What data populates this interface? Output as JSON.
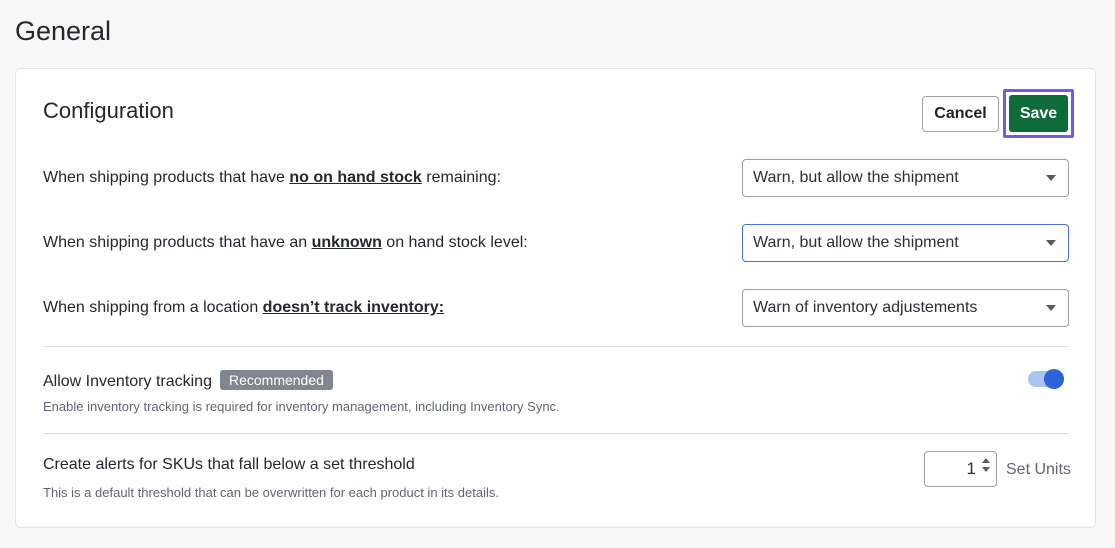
{
  "page": {
    "title": "General"
  },
  "config": {
    "title": "Configuration",
    "cancel_label": "Cancel",
    "save_label": "Save",
    "rows": [
      {
        "prefix": "When shipping products that have ",
        "emphasis": "no on hand stock",
        "suffix": " remaining:",
        "selected": "Warn, but allow the shipment"
      },
      {
        "prefix": "When shipping products that have an ",
        "emphasis": "unknown",
        "suffix": " on hand stock level:",
        "selected": "Warn, but allow the shipment"
      },
      {
        "prefix": "When shipping from a location ",
        "emphasis": "doesn’t track inventory:",
        "suffix": "",
        "selected": "Warn of inventory adjustements"
      }
    ],
    "tracking": {
      "label": "Allow Inventory tracking",
      "badge": "Recommended",
      "description": "Enable inventory tracking is required for inventory management, including Inventory Sync.",
      "enabled": true
    },
    "alerts": {
      "label": "Create alerts for SKUs that fall below a set threshold",
      "description": "This is a default threshold that can be overwritten for each product in its details.",
      "value": "1",
      "units": "Set Units"
    }
  },
  "colors": {
    "save": "#0e6b3a",
    "focus_ring": "#6a5cf0",
    "toggle_on": "#2d63d6",
    "badge": "#7e8791"
  }
}
